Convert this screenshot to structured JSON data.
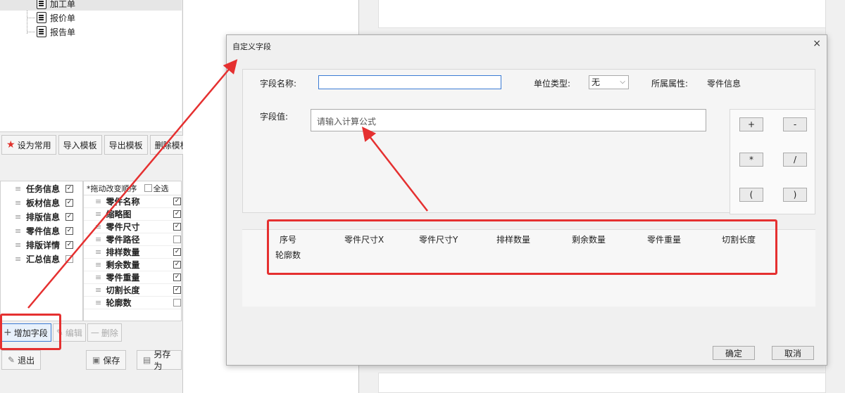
{
  "tree": {
    "items": [
      {
        "label": "加工单"
      },
      {
        "label": "报价单"
      },
      {
        "label": "报告单"
      }
    ]
  },
  "template_toolbar": {
    "set_common": "设为常用",
    "import": "导入模板",
    "export": "导出模板",
    "delete": "删除模板"
  },
  "categories": [
    {
      "label": "任务信息",
      "checked": true
    },
    {
      "label": "板材信息",
      "checked": true
    },
    {
      "label": "排版信息",
      "checked": true
    },
    {
      "label": "零件信息",
      "checked": true
    },
    {
      "label": "排版详情",
      "checked": true
    },
    {
      "label": "汇总信息",
      "checked": false
    }
  ],
  "field_panel": {
    "drag_hint": "*拖动改变顺序",
    "select_all": "全选",
    "fields": [
      {
        "label": "零件名称",
        "checked": true
      },
      {
        "label": "缩略图",
        "checked": true
      },
      {
        "label": "零件尺寸",
        "checked": true
      },
      {
        "label": "零件路径",
        "checked": false
      },
      {
        "label": "排样数量",
        "checked": true
      },
      {
        "label": "剩余数量",
        "checked": true
      },
      {
        "label": "零件重量",
        "checked": true
      },
      {
        "label": "切割长度",
        "checked": true
      },
      {
        "label": "轮廓数",
        "checked": false
      }
    ]
  },
  "field_actions": {
    "add": "增加字段",
    "edit": "编辑",
    "delete": "删除"
  },
  "bottom": {
    "exit": "退出",
    "save": "保存",
    "save_as": "另存为"
  },
  "dialog": {
    "title": "自定义字段",
    "close": "×",
    "field_name_label": "字段名称:",
    "field_name_value": "",
    "unit_type_label": "单位类型:",
    "unit_type_value": "无",
    "belongs_label": "所属属性:",
    "belongs_value": "零件信息",
    "field_value_label": "字段值:",
    "formula_placeholder": "请输入计算公式",
    "calc": [
      "+",
      "-",
      "*",
      "/",
      "(",
      ")"
    ],
    "variables": [
      "序号",
      "零件尺寸X",
      "零件尺寸Y",
      "排样数量",
      "剩余数量",
      "零件重量",
      "切割长度",
      "轮廓数"
    ],
    "ok": "确定",
    "cancel": "取消"
  },
  "colors": {
    "annotation": "#e53030",
    "focus_blue": "#3b7bd4"
  }
}
